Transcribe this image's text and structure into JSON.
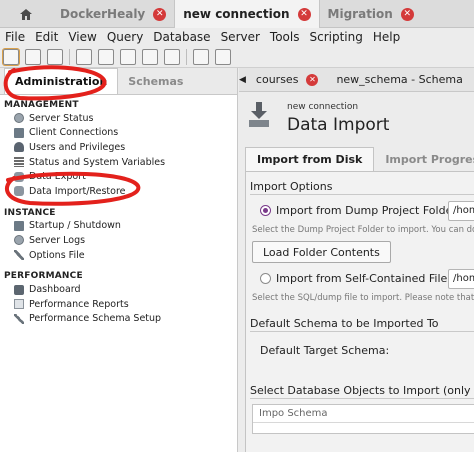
{
  "connection_tabs": [
    {
      "label": "DockerHealy",
      "active": false
    },
    {
      "label": "new connection",
      "active": true
    },
    {
      "label": "Migration",
      "active": false
    }
  ],
  "menu": [
    "File",
    "Edit",
    "View",
    "Query",
    "Database",
    "Server",
    "Tools",
    "Scripting",
    "Help"
  ],
  "sidebar": {
    "tabs": [
      "Administration",
      "Schemas"
    ],
    "management_header": "MANAGEMENT",
    "management_items": [
      "Server Status",
      "Client Connections",
      "Users and Privileges",
      "Status and System Variables",
      "Data Export",
      "Data Import/Restore"
    ],
    "instance_header": "INSTANCE",
    "instance_items": [
      "Startup / Shutdown",
      "Server Logs",
      "Options File"
    ],
    "performance_header": "PERFORMANCE",
    "performance_items": [
      "Dashboard",
      "Performance Reports",
      "Performance Schema Setup"
    ]
  },
  "doc_tabs": [
    "courses",
    "new_schema - Schema"
  ],
  "data_import": {
    "subtitle": "new connection",
    "title": "Data Import",
    "tabs": [
      "Import from Disk",
      "Import Progress"
    ],
    "import_options_title": "Import Options",
    "dump_folder_label": "Import from Dump Project Folder",
    "dump_folder_value": "/home",
    "dump_folder_hint": "Select the Dump Project Folder to import. You can do",
    "load_button": "Load Folder Contents",
    "self_contained_label": "Import from Self-Contained File",
    "self_contained_value": "/home",
    "self_contained_hint": "Select the SQL/dump file to import. Please note that t",
    "default_schema_title": "Default Schema to be Imported To",
    "default_target_label": "Default Target Schema:",
    "objects_title": "Select Database Objects to Import (only available",
    "table_header": "Impo Schema"
  },
  "colors": {
    "accent_purple": "#7a3a8a",
    "close_red": "#d43a3a",
    "annotation_red": "#e3211c"
  }
}
